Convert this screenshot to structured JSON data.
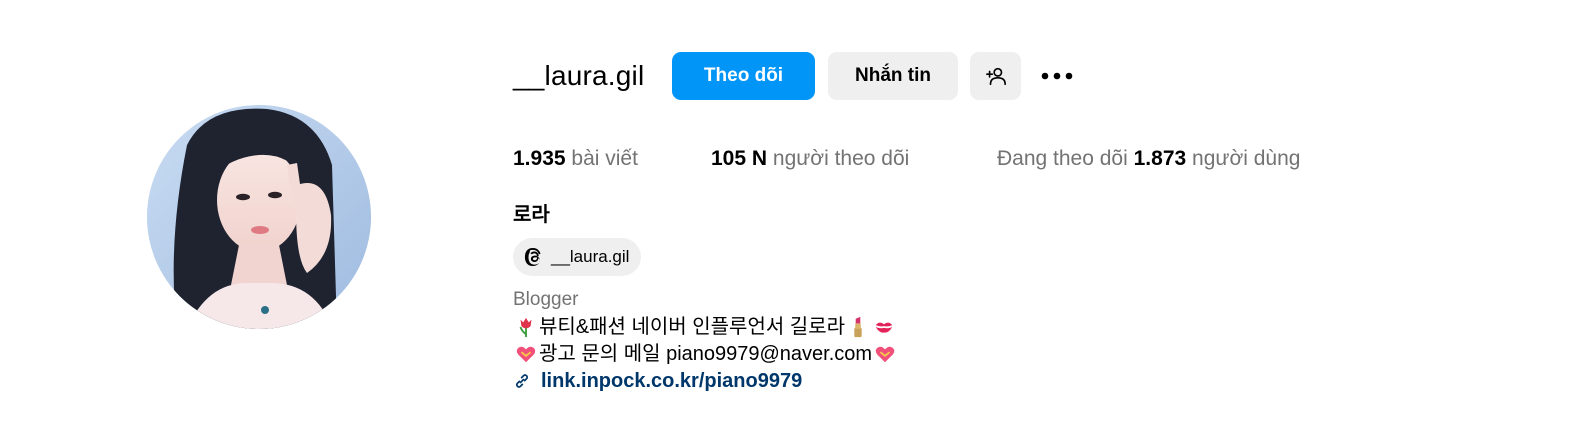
{
  "profile": {
    "username": "__laura.gil",
    "full_name": "로라",
    "category": "Blogger"
  },
  "actions": {
    "follow_label": "Theo dõi",
    "message_label": "Nhắn tin",
    "suggest_icon": "person-add-icon",
    "more_icon": "more-dots-icon"
  },
  "stats": {
    "posts_count": "1.935",
    "posts_label": "bài viết",
    "followers_count": "105 N",
    "followers_label": "người theo dõi",
    "following_prefix": "Đang theo dõi",
    "following_count": "1.873",
    "following_label": "người dùng"
  },
  "threads": {
    "icon": "threads-icon",
    "handle": "__laura.gil"
  },
  "bio": {
    "line1_text": "뷰티&패션 네이버 인플루언서 길로라",
    "line1_emojis": [
      "tulip-emoji",
      "lipstick-emoji",
      "kiss-mark-emoji"
    ],
    "line2_text": "광고 문의 메일 piano9979@naver.com",
    "line2_emojis": [
      "heart-with-ribbon-emoji",
      "heart-with-ribbon-emoji"
    ]
  },
  "link": {
    "icon": "link-icon",
    "text": "link.inpock.co.kr/piano9979"
  },
  "colors": {
    "accent": "#0095f6",
    "secondary_button": "#efefef",
    "muted_text": "#737373",
    "link_text": "#00376b"
  }
}
